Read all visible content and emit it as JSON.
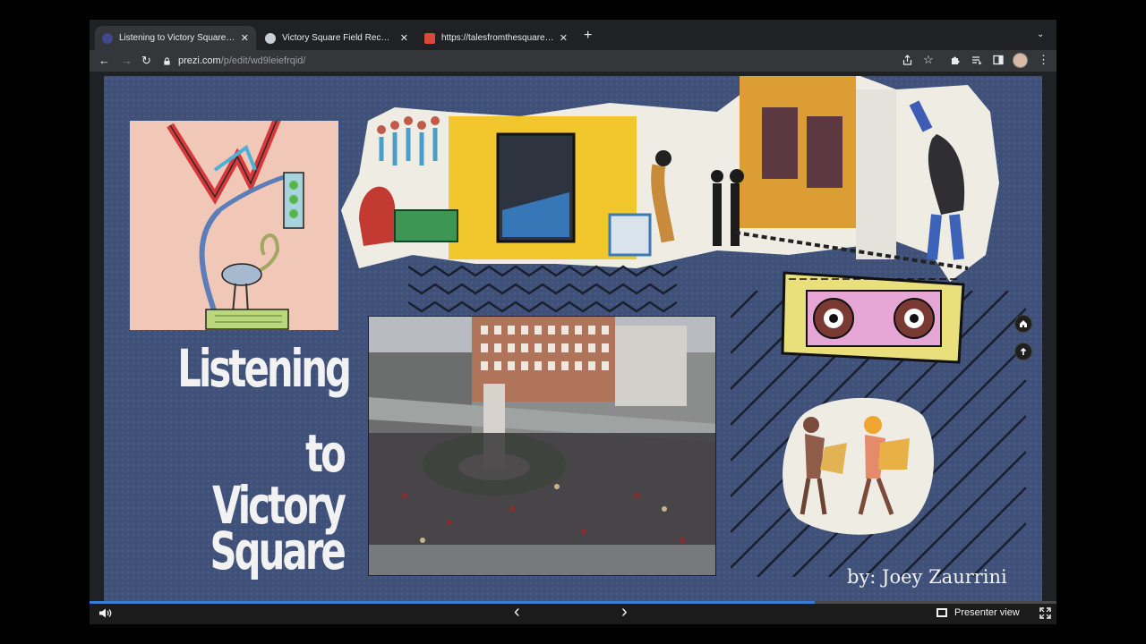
{
  "tabs": [
    {
      "title": "Listening to Victory Square | Pr",
      "favicon_color": "#3e4a8c",
      "active": true
    },
    {
      "title": "Victory Square Field Recordings",
      "favicon_color": "#c9ced6",
      "active": false
    },
    {
      "title": "https://talesfromthesquare.com",
      "favicon_color": "#d9483b",
      "active": false
    }
  ],
  "toolbar": {
    "new_tab_glyph": "+",
    "back_glyph": "←",
    "forward_glyph": "→",
    "reload_glyph": "↻",
    "url_host": "prezi.com",
    "url_path": "/p/edit/wd9leiefrqid/"
  },
  "presentation": {
    "title_lines": [
      "Listening",
      "to Victory",
      "Square"
    ],
    "byline": "by: Joey Zaurrini",
    "background_color": "#3f5178"
  },
  "side_nav": {
    "home_icon": "home-icon",
    "back_icon": "return-icon"
  },
  "bottom_bar": {
    "presenter_view_label": "Presenter view",
    "progress_fraction": 0.75,
    "volume_icon": "speaker-icon",
    "prev_glyph": "‹",
    "next_glyph": "›",
    "fullscreen_icon": "fullscreen-icon"
  }
}
